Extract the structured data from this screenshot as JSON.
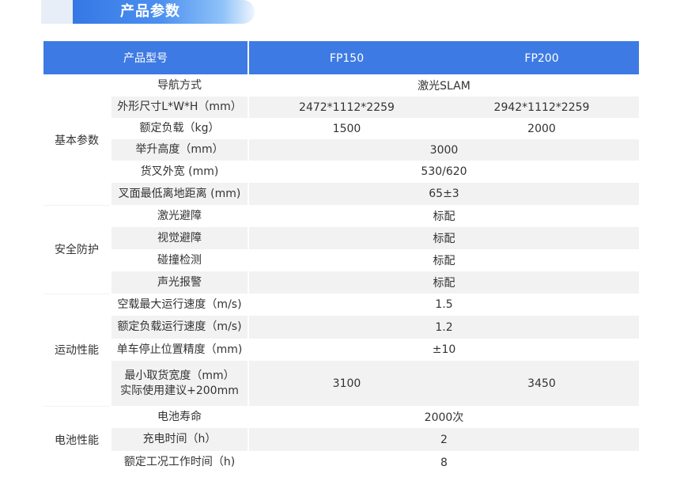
{
  "section_title": "产品参数",
  "header": {
    "model": "产品型号",
    "col1": "FP150",
    "col2": "FP200"
  },
  "groups": [
    {
      "label": "基本参数",
      "rows": [
        {
          "name": "导航方式",
          "merged": "激光SLAM"
        },
        {
          "name": "外形尺寸L*W*H（mm）",
          "v1": "2472*1112*2259",
          "v2": "2942*1112*2259"
        },
        {
          "name": "额定负载（kg）",
          "v1": "1500",
          "v2": "2000"
        },
        {
          "name": "举升高度（mm）",
          "merged": "3000"
        },
        {
          "name": "货叉外宽 (mm)",
          "merged": "530/620"
        },
        {
          "name": "叉面最低离地距离 (mm)",
          "merged": "65±3"
        }
      ]
    },
    {
      "label": "安全防护",
      "rows": [
        {
          "name": "激光避障",
          "merged": "标配"
        },
        {
          "name": "视觉避障",
          "merged": "标配"
        },
        {
          "name": "碰撞检测",
          "merged": "标配"
        },
        {
          "name": "声光报警",
          "merged": "标配"
        }
      ]
    },
    {
      "label": "运动性能",
      "rows": [
        {
          "name": "空载最大运行速度（m/s)",
          "merged": "1.5"
        },
        {
          "name": "额定负载运行速度（m/s)",
          "merged": "1.2"
        },
        {
          "name": "单车停止位置精度（mm)",
          "merged": "±10"
        },
        {
          "name": "最小取货宽度（mm）",
          "name2": "实际使用建议+200mm",
          "v1": "3100",
          "v2": "3450"
        }
      ]
    },
    {
      "label": "电池性能",
      "rows": [
        {
          "name": "电池寿命",
          "merged": "2000次"
        },
        {
          "name": "充电时间（h）",
          "merged": "2"
        },
        {
          "name": "额定工况工作时间（h)",
          "merged": "8"
        }
      ]
    }
  ]
}
